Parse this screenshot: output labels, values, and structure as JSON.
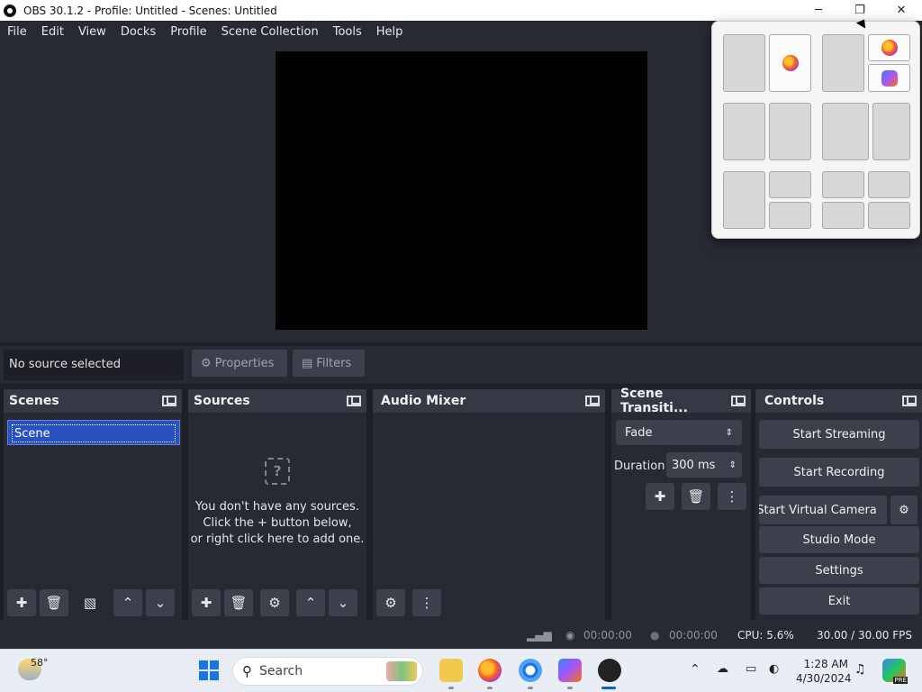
{
  "window": {
    "title": "OBS 30.1.2 - Profile: Untitled - Scenes: Untitled",
    "minimize": "─",
    "maximize": "❐",
    "close": "✕"
  },
  "menu": [
    "File",
    "Edit",
    "View",
    "Docks",
    "Profile",
    "Scene Collection",
    "Tools",
    "Help"
  ],
  "source_bar": {
    "status": "No source selected",
    "properties_label": "Properties",
    "filters_label": "Filters"
  },
  "scenes": {
    "title": "Scenes",
    "items": [
      "Scene"
    ]
  },
  "sources": {
    "title": "Sources",
    "empty_line1": "You don't have any sources.",
    "empty_line2": "Click the + button below,",
    "empty_line3": "or right click here to add one."
  },
  "audio_mixer": {
    "title": "Audio Mixer"
  },
  "transitions": {
    "title": "Scene Transiti...",
    "selected": "Fade",
    "duration_label": "Duration",
    "duration_value": "300 ms"
  },
  "controls": {
    "title": "Controls",
    "start_streaming": "Start Streaming",
    "start_recording": "Start Recording",
    "start_virtual_camera": "Start Virtual Camera",
    "studio_mode": "Studio Mode",
    "settings": "Settings",
    "exit": "Exit"
  },
  "status": {
    "stream_time": "00:00:00",
    "record_time": "00:00:00",
    "cpu": "CPU: 5.6%",
    "fps": "30.00 / 30.00 FPS"
  },
  "taskbar": {
    "weather_temp": "58°",
    "search_placeholder": "Search",
    "time": "1:28 AM",
    "date": "4/30/2024",
    "copilot_badge": "PRE"
  },
  "colors": {
    "dock_bg": "#272a33",
    "dock_header": "#353944",
    "button": "#3c404b",
    "scene_selected": "#2a52be",
    "taskbar_bg": "#e9eef4"
  }
}
